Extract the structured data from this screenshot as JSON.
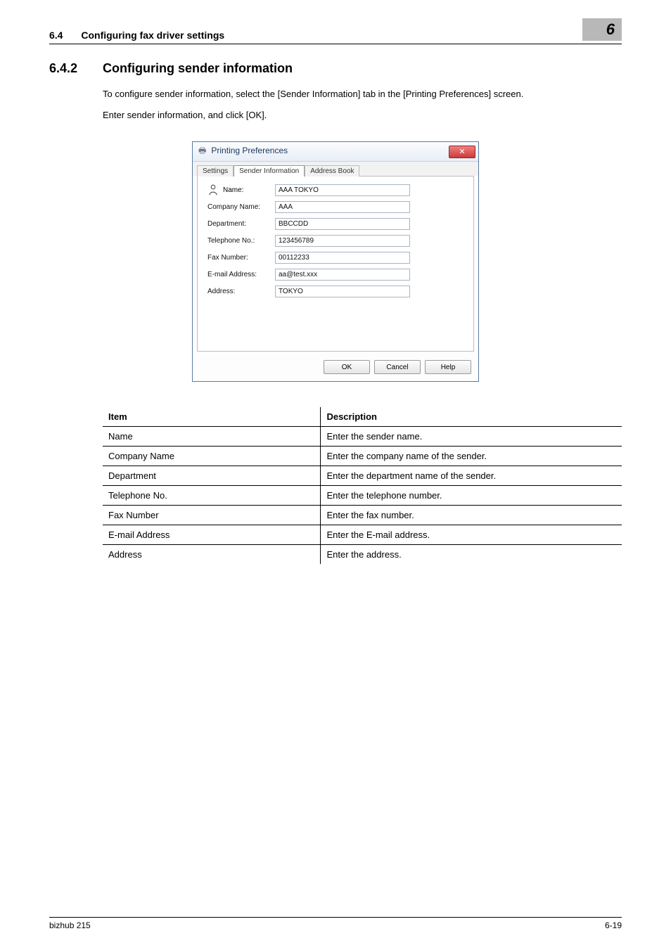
{
  "header": {
    "section_number": "6.4",
    "section_title": "Configuring fax driver settings",
    "chapter_badge": "6"
  },
  "subsection": {
    "number": "6.4.2",
    "title": "Configuring sender information",
    "para1": "To configure sender information, select the [Sender Information] tab in the [Printing Preferences] screen.",
    "para2": "Enter sender information, and click [OK]."
  },
  "dialog": {
    "window_title": "Printing Preferences",
    "close_glyph": "✕",
    "tabs": {
      "settings": "Settings",
      "sender_info": "Sender Information",
      "address_book": "Address Book"
    },
    "fields": {
      "name_label": "Name:",
      "name_value": "AAA TOKYO",
      "company_label": "Company Name:",
      "company_value": "AAA",
      "department_label": "Department:",
      "department_value": "BBCCDD",
      "telephone_label": "Telephone No.:",
      "telephone_value": "123456789",
      "fax_label": "Fax Number:",
      "fax_value": "00112233",
      "email_label": "E-mail Address:",
      "email_value": "aa@test.xxx",
      "address_label": "Address:",
      "address_value": "TOKYO"
    },
    "buttons": {
      "ok": "OK",
      "cancel": "Cancel",
      "help": "Help"
    }
  },
  "table": {
    "headers": {
      "item": "Item",
      "description": "Description"
    },
    "rows": [
      {
        "item": "Name",
        "desc": "Enter the sender name."
      },
      {
        "item": "Company Name",
        "desc": "Enter the company name of the sender."
      },
      {
        "item": "Department",
        "desc": "Enter the department name of the sender."
      },
      {
        "item": "Telephone No.",
        "desc": "Enter the telephone number."
      },
      {
        "item": "Fax Number",
        "desc": "Enter the fax number."
      },
      {
        "item": "E-mail Address",
        "desc": "Enter the E-mail address."
      },
      {
        "item": "Address",
        "desc": "Enter the address."
      }
    ]
  },
  "footer": {
    "left": "bizhub 215",
    "right": "6-19"
  }
}
